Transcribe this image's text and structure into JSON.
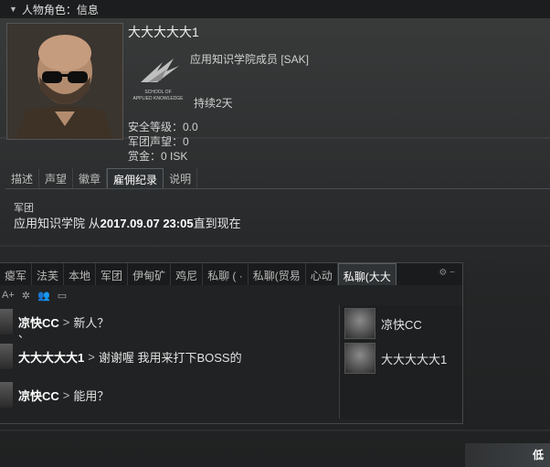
{
  "window": {
    "title": "人物角色：信息"
  },
  "character": {
    "name": "大大大大大1",
    "corp_membership": "应用知识学院成员 [SAK]",
    "corp_logo_line1": "SCHOOL OF",
    "corp_logo_line2": "APPLIED KNOWLEDGE",
    "duration": "持续2天",
    "security_status": "安全等级：0.0",
    "corp_standing": "军团声望：0",
    "bounty": "赏金：0 ISK"
  },
  "tabs": [
    {
      "label": "描述"
    },
    {
      "label": "声望"
    },
    {
      "label": "徽章"
    },
    {
      "label": "雇佣纪录",
      "active": true
    },
    {
      "label": "说明"
    }
  ],
  "employment": {
    "section_label": "军团",
    "corp_name": "应用知识学院",
    "from_word": " 从",
    "date_range": "2017.09.07 23:05",
    "to_now": "直到现在"
  },
  "chat": {
    "tabs": [
      {
        "label": "瘪军"
      },
      {
        "label": "法芙"
      },
      {
        "label": "本地"
      },
      {
        "label": "军团"
      },
      {
        "label": "伊甸矿"
      },
      {
        "label": "鸡尼"
      },
      {
        "label": "私聊 ( ·"
      },
      {
        "label": "私聊(贸易"
      },
      {
        "label": "心动"
      },
      {
        "label": "私聊(大大",
        "active": true
      }
    ],
    "window_controls": "⚙ −",
    "toolbar": {
      "font_size_label": "A+"
    },
    "messages": [
      {
        "sender": "凉快CC",
        "separator": ">",
        "text": "新人？",
        "extra": "、"
      },
      {
        "sender": "大大大大大1",
        "separator": ">",
        "text": "谢谢喔  我用来打下BOSS的"
      },
      {
        "sender": "凉快CC",
        "separator": ">",
        "text": "能用？"
      }
    ],
    "members": [
      {
        "name": "凉快CC"
      },
      {
        "name": "大大大大大1"
      }
    ]
  },
  "corner_label": "低"
}
